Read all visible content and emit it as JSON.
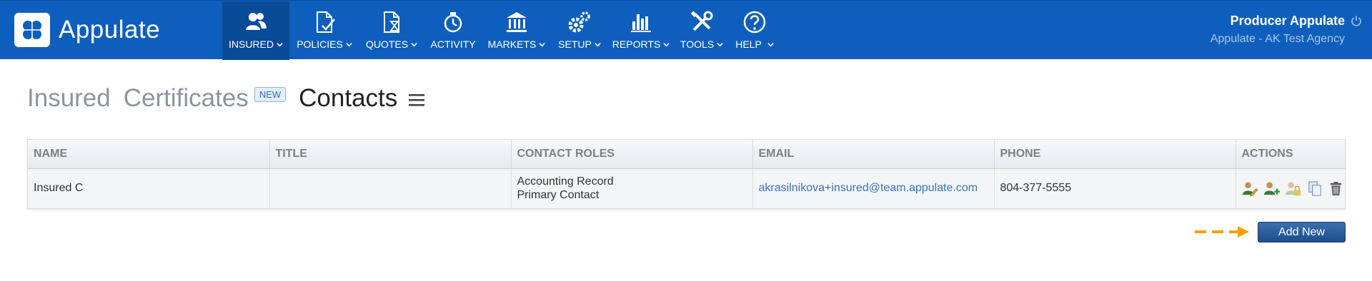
{
  "app": {
    "name": "Appulate"
  },
  "nav": [
    {
      "label": "INSURED",
      "icon": "users-icon",
      "active": true
    },
    {
      "label": "POLICIES",
      "icon": "document-check-icon"
    },
    {
      "label": "QUOTES",
      "icon": "document-hourglass-icon"
    },
    {
      "label": "ACTIVITY",
      "icon": "stopwatch-icon"
    },
    {
      "label": "MARKETS",
      "icon": "bank-icon"
    },
    {
      "label": "SETUP",
      "icon": "gears-icon"
    },
    {
      "label": "REPORTS",
      "icon": "bar-chart-icon"
    },
    {
      "label": "TOOLS",
      "icon": "tools-icon"
    },
    {
      "label": "HELP",
      "icon": "help-icon"
    }
  ],
  "user": {
    "name": "Producer Appulate",
    "agency": "Appulate - AK Test Agency"
  },
  "tabs": {
    "insured": "Insured",
    "certificates": "Certificates",
    "new_badge": "NEW",
    "contacts": "Contacts"
  },
  "table": {
    "headers": [
      "NAME",
      "TITLE",
      "CONTACT ROLES",
      "EMAIL",
      "PHONE",
      "ACTIONS"
    ],
    "rows": [
      {
        "name": "Insured C",
        "title": "",
        "roles": [
          "Accounting Record",
          "Primary Contact"
        ],
        "email": "akrasilnikova+insured@team.appulate.com",
        "phone": "804-377-5555",
        "actions": [
          "edit-user-icon",
          "add-user-icon",
          "lock-user-icon",
          "copy-icon",
          "trash-icon"
        ]
      }
    ]
  },
  "add_new": {
    "label": "Add New"
  },
  "colors": {
    "brand": "#0e5fbd",
    "active_nav": "#0a4b97",
    "arrow": "#f4a100",
    "button": "#2a5c9a"
  }
}
